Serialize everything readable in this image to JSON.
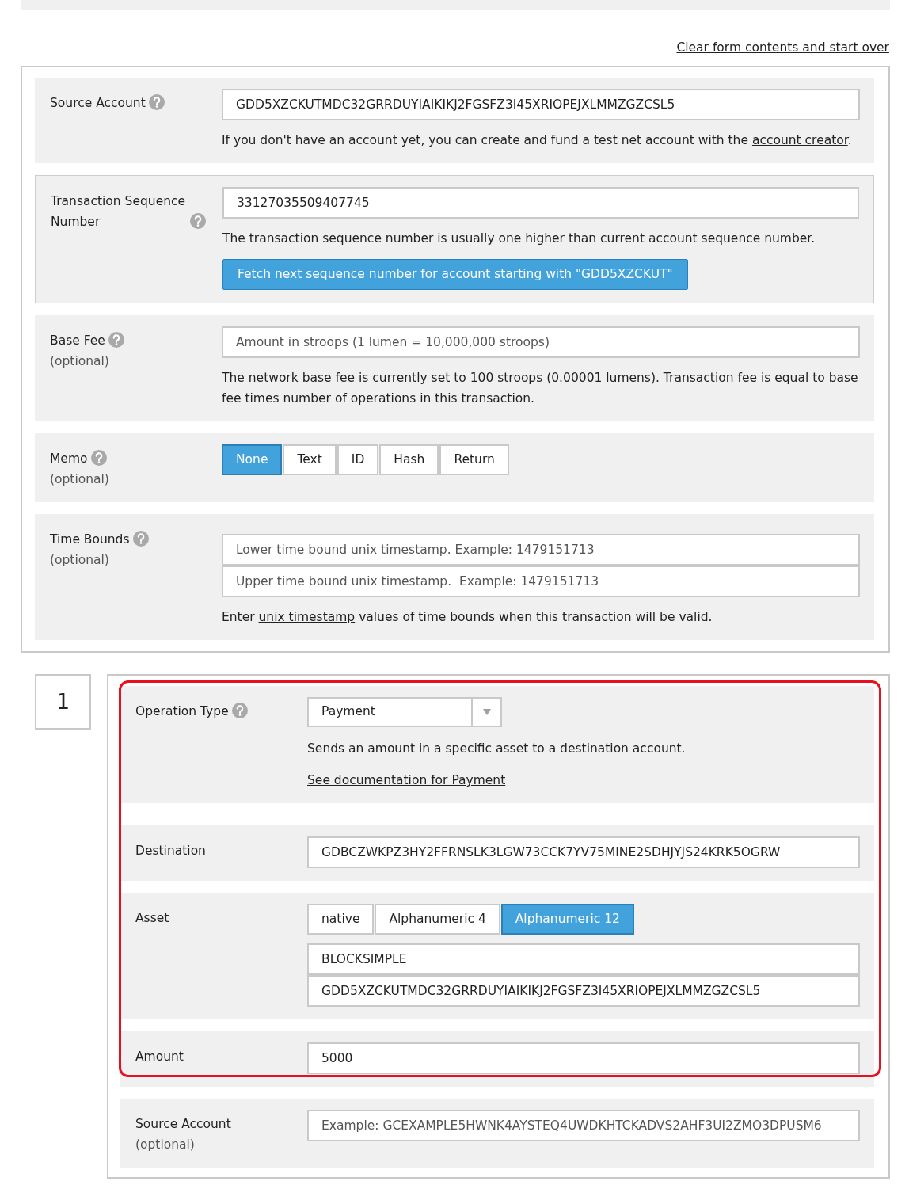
{
  "top_link": "Clear form contents and start over",
  "transaction": {
    "fields": [
      {
        "label": "Source Account",
        "help_icon": true,
        "outlined": false,
        "controls": [
          {
            "kind": "input",
            "value": "GDD5XZCKUTMDC32GRRDUYIAIKIKJ2FGSFZ3I45XRIOPEJXLMMZGZCSL5"
          },
          {
            "kind": "paragraph",
            "parts": [
              {
                "text": "If you don't have an account yet, you can create and fund a test net account with the "
              },
              {
                "link": "account creator"
              },
              {
                "text": "."
              }
            ]
          }
        ]
      },
      {
        "label": "Transaction Sequence Number",
        "help_icon": true,
        "outlined": true,
        "controls": [
          {
            "kind": "input",
            "value": "33127035509407745"
          },
          {
            "kind": "paragraph",
            "parts": [
              {
                "text": "The transaction sequence number is usually one higher than current account sequence number."
              }
            ]
          },
          {
            "kind": "button",
            "label": "Fetch next sequence number for account starting with \"GDD5XZCKUT\""
          }
        ]
      },
      {
        "label": "Base Fee",
        "note": "(optional)",
        "help_icon": true,
        "outlined": false,
        "controls": [
          {
            "kind": "input",
            "placeholder": "Amount in stroops (1 lumen = 10,000,000 stroops)"
          },
          {
            "kind": "paragraph",
            "parts": [
              {
                "text": "The "
              },
              {
                "link": "network base fee"
              },
              {
                "text": " is currently set to 100 stroops (0.00001 lumens). Transaction fee is equal to base fee times number of operations in this transaction."
              }
            ]
          }
        ]
      },
      {
        "label": "Memo",
        "note": "(optional)",
        "help_icon": true,
        "outlined": false,
        "controls": [
          {
            "kind": "segmented",
            "options": [
              {
                "label": "None",
                "selected": true
              },
              {
                "label": "Text",
                "selected": false
              },
              {
                "label": "ID",
                "selected": false
              },
              {
                "label": "Hash",
                "selected": false
              },
              {
                "label": "Return",
                "selected": false
              }
            ]
          }
        ]
      },
      {
        "label": "Time Bounds",
        "note": "(optional)",
        "help_icon": true,
        "outlined": false,
        "controls": [
          {
            "kind": "input_stack",
            "inputs": [
              {
                "placeholder": "Lower time bound unix timestamp. Example: 1479151713"
              },
              {
                "placeholder": "Upper time bound unix timestamp.  Example: 1479151713"
              }
            ]
          },
          {
            "kind": "paragraph",
            "parts": [
              {
                "text": "Enter "
              },
              {
                "link": "unix timestamp"
              },
              {
                "text": " values of time bounds when this transaction will be valid."
              }
            ]
          }
        ]
      }
    ]
  },
  "operations": [
    {
      "number": "1",
      "fields": [
        {
          "label": "Operation Type",
          "help_icon": true,
          "highlighted": true,
          "controls": [
            {
              "kind": "select",
              "value": "Payment"
            },
            {
              "kind": "paragraph",
              "parts": [
                {
                  "text": "Sends an amount in a specific asset to a destination account."
                }
              ]
            },
            {
              "kind": "paragraph",
              "parts": [
                {
                  "link": "See documentation for Payment"
                }
              ]
            }
          ]
        },
        {
          "label": "Destination",
          "help_icon": false,
          "highlighted": true,
          "controls": [
            {
              "kind": "input",
              "value": "GDBCZWKPZ3HY2FFRNSLK3LGW73CCK7YV75MINE2SDHJYJS24KRK5OGRW"
            }
          ]
        },
        {
          "label": "Asset",
          "help_icon": false,
          "highlighted": true,
          "controls": [
            {
              "kind": "segmented",
              "options": [
                {
                  "label": "native",
                  "selected": false
                },
                {
                  "label": "Alphanumeric 4",
                  "selected": false
                },
                {
                  "label": "Alphanumeric 12",
                  "selected": true
                }
              ]
            },
            {
              "kind": "input_stack",
              "inputs": [
                {
                  "value": "BLOCKSIMPLE"
                },
                {
                  "value": "GDD5XZCKUTMDC32GRRDUYIAIKIKJ2FGSFZ3I45XRIOPEJXLMMZGZCSL5"
                }
              ]
            }
          ]
        },
        {
          "label": "Amount",
          "help_icon": false,
          "highlighted": true,
          "controls": [
            {
              "kind": "input",
              "value": "5000"
            }
          ]
        },
        {
          "label": "Source Account",
          "note": "(optional)",
          "help_icon": false,
          "highlighted": false,
          "controls": [
            {
              "kind": "input",
              "placeholder": "Example: GCEXAMPLE5HWNK4AYSTEQ4UWDKHTCKADVS2AHF3UI2ZMO3DPUSM6"
            }
          ]
        }
      ]
    }
  ]
}
